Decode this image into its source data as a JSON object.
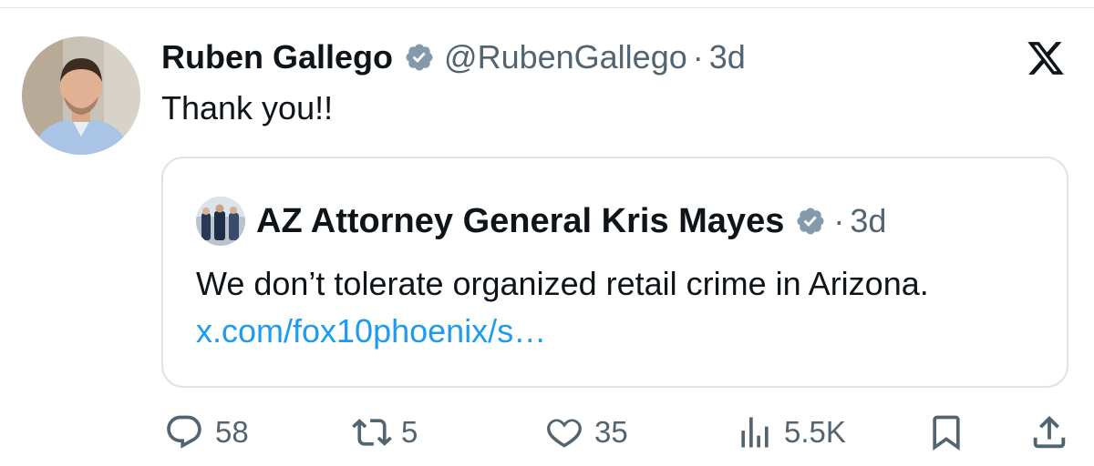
{
  "tweet": {
    "author": {
      "name": "Ruben Gallego",
      "handle": "@RubenGallego",
      "verified": true
    },
    "separator": "·",
    "time": "3d",
    "text": "Thank you!!",
    "platform_logo": "x-logo-icon"
  },
  "quote": {
    "author": {
      "name": "AZ Attorney General Kris Mayes",
      "verified": true
    },
    "separator": "·",
    "time": "3d",
    "text": "We don’t tolerate organized retail crime in Arizona.",
    "link_text": "x.com/fox10phoenix/s…"
  },
  "actions": {
    "replies": {
      "icon": "reply-icon",
      "count": "58"
    },
    "reposts": {
      "icon": "repost-icon",
      "count": "5"
    },
    "likes": {
      "icon": "like-icon",
      "count": "35"
    },
    "views": {
      "icon": "views-icon",
      "count": "5.5K"
    },
    "bookmark": {
      "icon": "bookmark-icon"
    },
    "share": {
      "icon": "share-icon"
    }
  },
  "colors": {
    "text": "#0f1419",
    "secondary": "#536471",
    "link": "#1d9bf0",
    "verified_badge": "#829aab",
    "border": "#dfe3e6"
  }
}
